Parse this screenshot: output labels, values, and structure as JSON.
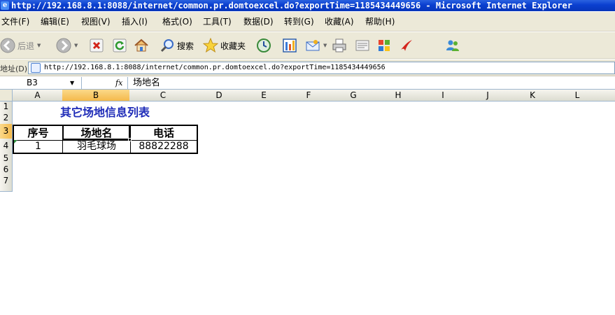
{
  "window": {
    "title": "http://192.168.8.1:8088/internet/common.pr.domtoexcel.do?exportTime=1185434449656 - Microsoft Internet Explorer"
  },
  "menu": [
    {
      "label": "文件(F)"
    },
    {
      "label": "编辑(E)"
    },
    {
      "label": "视图(V)"
    },
    {
      "label": "插入(I)"
    },
    {
      "label": "格式(O)"
    },
    {
      "label": "工具(T)"
    },
    {
      "label": "数据(D)"
    },
    {
      "label": "转到(G)"
    },
    {
      "label": "收藏(A)"
    },
    {
      "label": "帮助(H)"
    }
  ],
  "toolbar": {
    "back_label": "后退",
    "search_label": "搜索",
    "favorites_label": "收藏夹"
  },
  "address": {
    "label": "地址(D)",
    "url": "http://192.168.8.1:8088/internet/common.pr.domtoexcel.do?exportTime=1185434449656"
  },
  "formula": {
    "cell_ref": "B3",
    "fx": "fx",
    "value": "场地名"
  },
  "columns": [
    "A",
    "B",
    "C",
    "D",
    "E",
    "F",
    "G",
    "H",
    "I",
    "J",
    "K",
    "L"
  ],
  "rows": [
    "1",
    "2",
    "3",
    "4",
    "5",
    "6",
    "7"
  ],
  "sheet": {
    "title": "其它场地信息列表",
    "headers": [
      "序号",
      "场地名",
      "电话"
    ],
    "rows": [
      [
        "1",
        "羽毛球场",
        "88822288"
      ]
    ]
  },
  "colors": {
    "title_blue": "#1f2cb8",
    "selection_orange": "#f4b94b",
    "titlebar_blue": "#0a3fcf"
  }
}
